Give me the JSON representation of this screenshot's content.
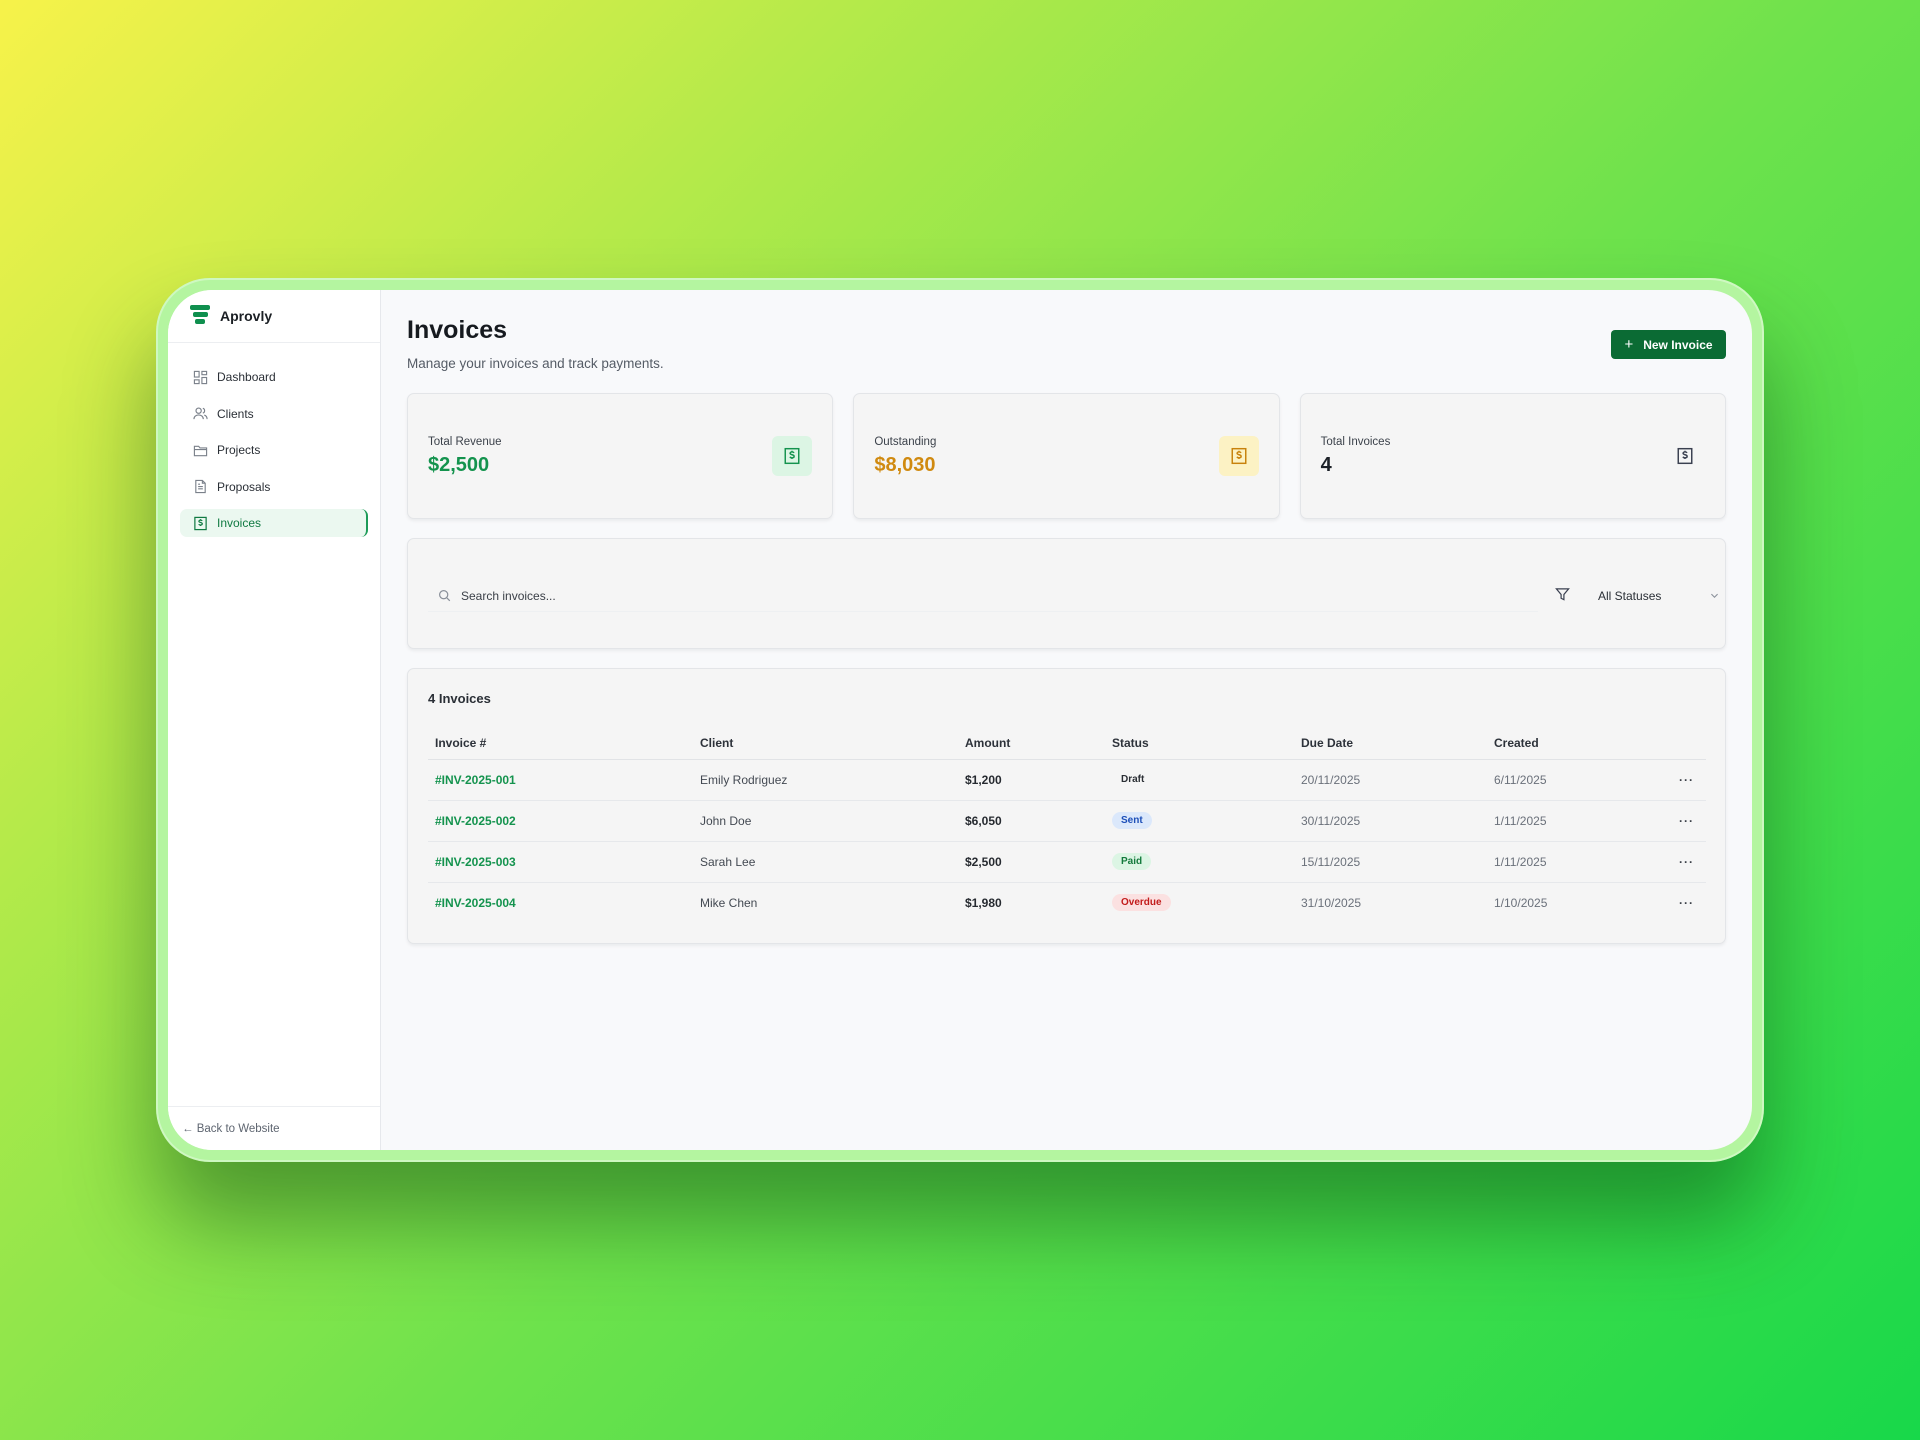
{
  "app": {
    "name": "Aprovly"
  },
  "sidebar": {
    "items": [
      {
        "label": "Dashboard",
        "icon": "dashboard-icon"
      },
      {
        "label": "Clients",
        "icon": "users-icon"
      },
      {
        "label": "Projects",
        "icon": "folder-icon"
      },
      {
        "label": "Proposals",
        "icon": "document-icon"
      },
      {
        "label": "Invoices",
        "icon": "invoice-icon",
        "active": true
      }
    ],
    "back_label": "← Back to Website"
  },
  "header": {
    "title": "Invoices",
    "subtitle": "Manage your invoices and track payments.",
    "new_button": "New Invoice"
  },
  "stats": [
    {
      "label": "Total Revenue",
      "value": "$2,500",
      "color": "#14934e",
      "badge_bg": "#dcf5e4",
      "icon_color": "#14934e"
    },
    {
      "label": "Outstanding",
      "value": "$8,030",
      "color": "#d08a10",
      "badge_bg": "#fcf2c4",
      "icon_color": "#c8820c"
    },
    {
      "label": "Total Invoices",
      "value": "4",
      "color": "#1c2128",
      "badge_bg": "transparent",
      "icon_color": "#3a4050"
    }
  ],
  "filters": {
    "search_placeholder": "Search invoices...",
    "status_selected": "All Statuses"
  },
  "table": {
    "count_title": "4 Invoices",
    "columns": [
      "Invoice #",
      "Client",
      "Amount",
      "Status",
      "Due Date",
      "Created"
    ],
    "rows": [
      {
        "invoice": "#INV-2025-001",
        "client": "Emily Rodriguez",
        "amount": "$1,200",
        "status": "Draft",
        "due": "20/11/2025",
        "created": "6/11/2025",
        "actions": "···"
      },
      {
        "invoice": "#INV-2025-002",
        "client": "John Doe",
        "amount": "$6,050",
        "status": "Sent",
        "due": "30/11/2025",
        "created": "1/11/2025",
        "actions": "···"
      },
      {
        "invoice": "#INV-2025-003",
        "client": "Sarah Lee",
        "amount": "$2,500",
        "status": "Paid",
        "due": "15/11/2025",
        "created": "1/11/2025",
        "actions": "···"
      },
      {
        "invoice": "#INV-2025-004",
        "client": "Mike Chen",
        "amount": "$1,980",
        "status": "Overdue",
        "due": "31/10/2025",
        "created": "1/10/2025",
        "actions": "···"
      }
    ]
  },
  "colors": {
    "accent": "#0b6b34",
    "link_green": "#14934e"
  }
}
